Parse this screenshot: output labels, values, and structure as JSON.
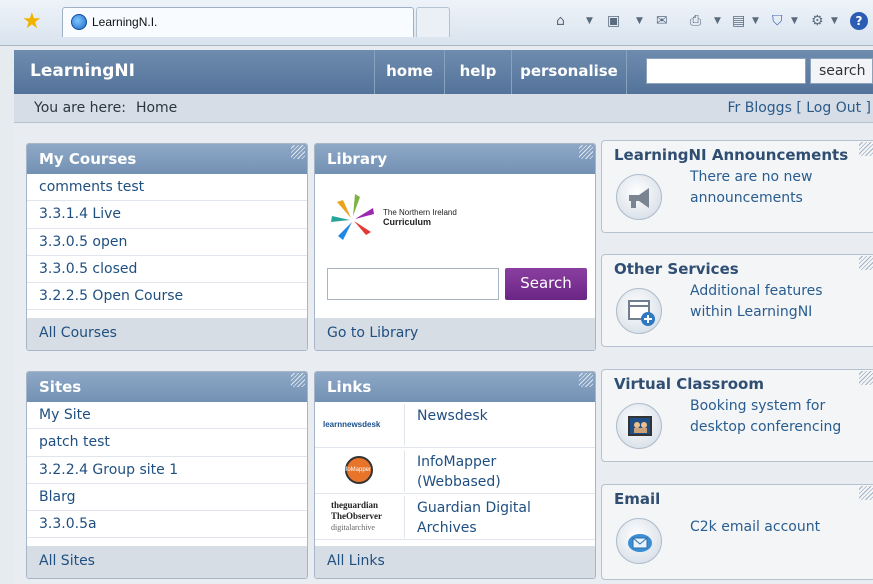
{
  "browser": {
    "tab_title": "LearningN.I."
  },
  "site": {
    "name": "LearningNI",
    "nav": [
      "home",
      "help",
      "personalise"
    ],
    "search_label": "search",
    "search_value": ""
  },
  "breadcrumb": {
    "prefix": "You are here:",
    "current": "Home"
  },
  "user": {
    "name": "Fr Bloggs",
    "logout": "[ Log Out ]"
  },
  "my_courses": {
    "title": "My Courses",
    "items": [
      "comments test",
      "3.3.1.4 Live",
      "3.3.0.5 open",
      "3.3.0.5 closed",
      "3.2.2.5 Open Course"
    ],
    "footer": "All Courses"
  },
  "library": {
    "title": "Library",
    "logo_line1": "The Northern Ireland",
    "logo_line2": "Curriculum",
    "search_label": "Search",
    "search_value": "",
    "footer": "Go to Library"
  },
  "sites": {
    "title": "Sites",
    "items": [
      "My Site",
      "patch test",
      "3.2.2.4 Group site 1",
      "Blarg",
      "3.3.0.5a"
    ],
    "footer": "All Sites"
  },
  "links": {
    "title": "Links",
    "items": [
      {
        "line1": "Newsdesk",
        "line2": "",
        "thumb1": "learnnewsdesk",
        "thumb2": ""
      },
      {
        "line1": "InfoMapper",
        "line2": "(Webbased)",
        "thumb1": "infoMapper",
        "thumb2": ""
      },
      {
        "line1": "Guardian Digital",
        "line2": "Archives",
        "thumb1": "theguardian",
        "thumb2": "TheObserver"
      }
    ],
    "thumb3_line3": "digitalarchive",
    "footer": "All Links"
  },
  "announcements": {
    "title": "LearningNI Announcements",
    "line1": "There are no new",
    "line2": "announcements"
  },
  "other_services": {
    "title": "Other Services",
    "line1": "Additional features",
    "line2": "within LearningNI"
  },
  "virtual_classroom": {
    "title": "Virtual Classroom",
    "line1": "Booking system for",
    "line2": "desktop conferencing"
  },
  "email": {
    "title": "Email",
    "line1": "C2k email account"
  },
  "colors": {
    "header": "#5f7ea4",
    "accent_purple": "#7a2f93",
    "link": "#1f4f80"
  }
}
